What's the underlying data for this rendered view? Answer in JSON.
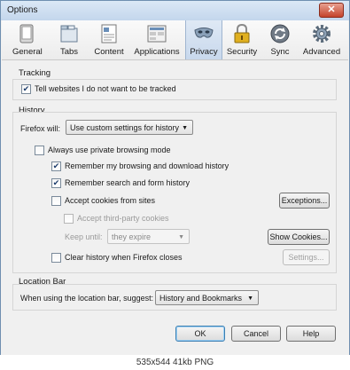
{
  "window": {
    "title": "Options",
    "close_glyph": "✕"
  },
  "toolbar": {
    "panes": [
      {
        "label": "General",
        "icon": "general-icon",
        "selected": false
      },
      {
        "label": "Tabs",
        "icon": "tabs-icon",
        "selected": false
      },
      {
        "label": "Content",
        "icon": "content-icon",
        "selected": false
      },
      {
        "label": "Applications",
        "icon": "applications-icon",
        "selected": false
      },
      {
        "label": "Privacy",
        "icon": "privacy-mask-icon",
        "selected": true
      },
      {
        "label": "Security",
        "icon": "padlock-icon",
        "selected": false
      },
      {
        "label": "Sync",
        "icon": "sync-icon",
        "selected": false
      },
      {
        "label": "Advanced",
        "icon": "gear-icon",
        "selected": false
      }
    ]
  },
  "tracking": {
    "title": "Tracking",
    "do_not_track_label": "Tell websites I do not want to be tracked",
    "do_not_track_checked": true
  },
  "history": {
    "title": "History",
    "firefox_will_label": "Firefox will:",
    "firefox_will_value": "Use custom settings for history",
    "private_label": "Always use private browsing mode",
    "private_checked": false,
    "remember_browsing_label": "Remember my browsing and download history",
    "remember_browsing_checked": true,
    "remember_search_label": "Remember search and form history",
    "remember_search_checked": true,
    "accept_cookies_label": "Accept cookies from sites",
    "accept_cookies_checked": false,
    "exceptions_label": "Exceptions...",
    "third_party_label": "Accept third-party cookies",
    "third_party_checked": false,
    "keep_until_label": "Keep until:",
    "keep_until_value": "they expire",
    "show_cookies_label": "Show Cookies...",
    "clear_history_label": "Clear history when Firefox closes",
    "clear_history_checked": false,
    "settings_label": "Settings..."
  },
  "location_bar": {
    "title": "Location Bar",
    "suggest_label": "When using the location bar, suggest:",
    "suggest_value": "History and Bookmarks"
  },
  "buttons": {
    "ok": "OK",
    "cancel": "Cancel",
    "help": "Help"
  },
  "image_caption": "535x544  41kb  PNG",
  "colors": {
    "selected_pane": "#c8d8ec",
    "default_button_border": "#3c7fb1",
    "check_mark": "#1a3a6a"
  }
}
